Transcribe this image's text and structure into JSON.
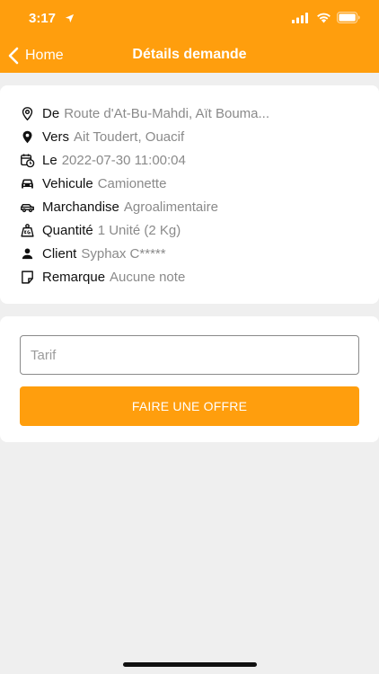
{
  "status_bar": {
    "time": "3:17"
  },
  "nav": {
    "back_label": "Home",
    "title": "Détails demande"
  },
  "details": [
    {
      "icon": "location-outline-icon",
      "label": "De",
      "value": "Route d'At-Bu-Mahdi, Aït Bouma..."
    },
    {
      "icon": "location-filled-icon",
      "label": "Vers",
      "value": "Ait Toudert, Ouacif"
    },
    {
      "icon": "calendar-clock-icon",
      "label": "Le",
      "value": "2022-07-30 11:00:04"
    },
    {
      "icon": "car-icon",
      "label": "Vehicule",
      "value": "Camionette"
    },
    {
      "icon": "car-side-icon",
      "label": "Marchandise",
      "value": "Agroalimentaire"
    },
    {
      "icon": "weight-icon",
      "label": "Quantité",
      "value": "1 Unité (2 Kg)"
    },
    {
      "icon": "person-icon",
      "label": "Client",
      "value": "Syphax C*****"
    },
    {
      "icon": "note-icon",
      "label": "Remarque",
      "value": "Aucune note"
    }
  ],
  "offer": {
    "tarif_placeholder": "Tarif",
    "button_label": "FAIRE UNE OFFRE"
  },
  "colors": {
    "accent": "#ff9e0d",
    "background": "#efefef",
    "value_text": "#8a8a8a"
  }
}
